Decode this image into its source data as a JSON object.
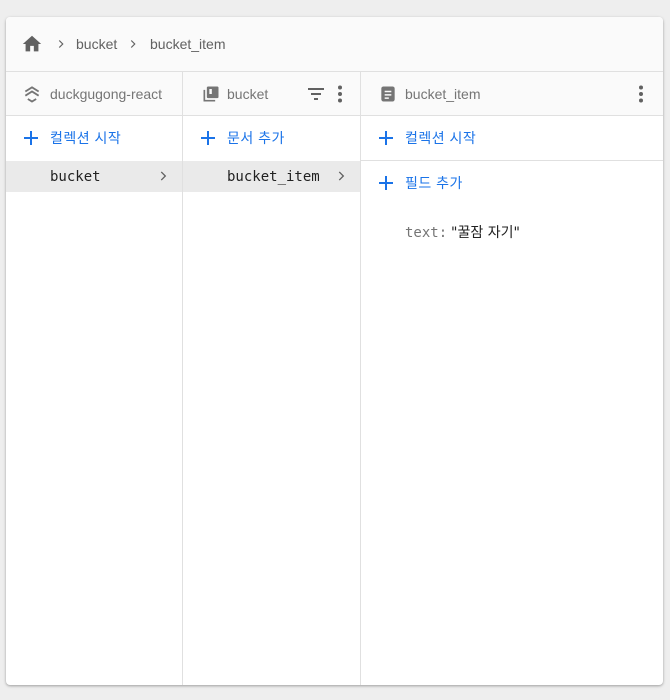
{
  "breadcrumb": {
    "home_icon": "home-icon",
    "items": [
      "bucket",
      "bucket_item"
    ]
  },
  "columns": [
    {
      "header_icon": "collections-stack-icon",
      "title": "duckgugong-react",
      "action_label": "컬렉션 시작",
      "items": [
        {
          "label": "bucket",
          "selected": true
        }
      ]
    },
    {
      "header_icon": "collection-icon",
      "title": "bucket",
      "filter_icon": "filter-icon",
      "more_icon": "more-vert-icon",
      "action_label": "문서 추가",
      "items": [
        {
          "label": "bucket_item",
          "selected": true
        }
      ]
    },
    {
      "header_icon": "document-icon",
      "title": "bucket_item",
      "more_icon": "more-vert-icon",
      "action_label": "컬렉션 시작",
      "field_action_label": "필드 추가",
      "fields": [
        {
          "key": "text:",
          "value": "\"꿀잠 자기\""
        }
      ]
    }
  ],
  "colors": {
    "accent": "#1a73e8",
    "selected_row": "#eaeaea",
    "header_bg": "#fafafa",
    "divider": "#e0e0e0"
  }
}
